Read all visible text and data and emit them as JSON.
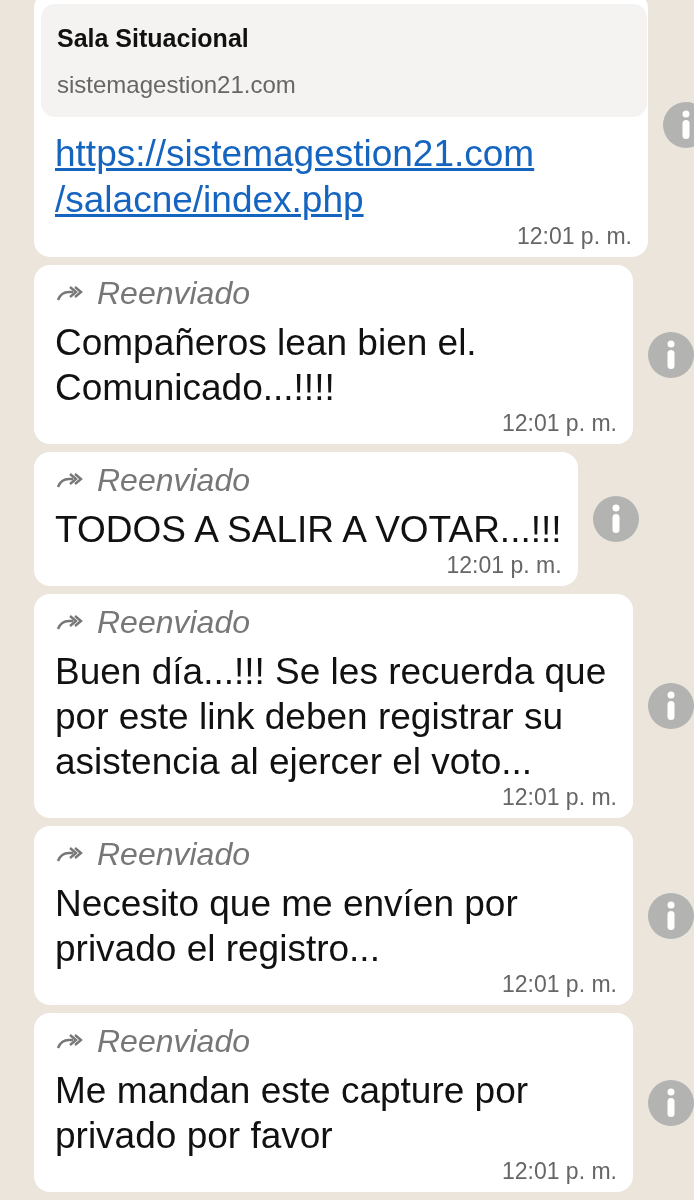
{
  "messages": [
    {
      "kind": "link",
      "preview": {
        "title": "Sala Situacional",
        "domain": "sistemagestion21.com"
      },
      "link": "https://sistemagestion21.com/salacne/index.php",
      "time": "12:01 p. m."
    },
    {
      "kind": "text",
      "forwarded_label": "Reenviado",
      "text": "Compañeros lean bien el. Comunicado...!!!!",
      "time": "12:01 p. m."
    },
    {
      "kind": "text",
      "forwarded_label": "Reenviado",
      "text": "TODOS A SALIR A VOTAR...!!!",
      "time": "12:01 p. m."
    },
    {
      "kind": "text",
      "forwarded_label": "Reenviado",
      "text": "Buen día...!!! Se les recuerda que por este link deben registrar su asistencia al ejercer el voto...",
      "time": "12:01 p. m."
    },
    {
      "kind": "text",
      "forwarded_label": "Reenviado",
      "text": "Necesito que me envíen por privado el registro...",
      "time": "12:01 p. m."
    },
    {
      "kind": "text",
      "forwarded_label": "Reenviado",
      "text": "Me mandan este capture por privado por favor",
      "time": "12:01 p. m."
    }
  ]
}
